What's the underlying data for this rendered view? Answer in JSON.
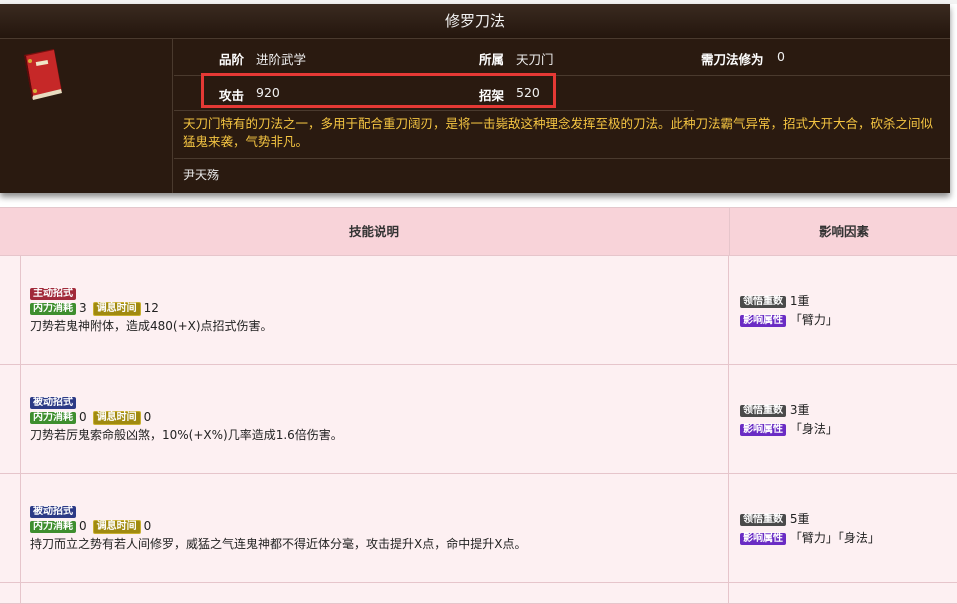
{
  "header": {
    "title": "修罗刀法",
    "grade_label": "品阶",
    "grade_value": "进阶武学",
    "belong_label": "所属",
    "belong_value": "天刀门",
    "req_label": "需刀法修为",
    "req_value": "0",
    "attack_label": "攻击",
    "attack_value": "920",
    "parry_label": "招架",
    "parry_value": "520",
    "description": "天刀门特有的刀法之一，多用于配合重刀阔刃，是将一击毙敌这种理念发挥至极的刀法。此种刀法霸气异常，招式大开大合，砍杀之间似猛鬼来袭，气势非凡。",
    "author": "尹天殇",
    "icon": "red-book-icon"
  },
  "table": {
    "col1_header": "技能说明",
    "col2_header": "影响因素",
    "tag_neili": "内力消耗",
    "tag_cd": "调息时间",
    "tag_level": "领悟重数",
    "tag_attr": "影响属性",
    "rows": [
      {
        "type": "主动招式",
        "neili": "3",
        "cd": "12",
        "text": "刀势若鬼神附体，造成480(+X)点招式伤害。",
        "level": "1重",
        "attrs": "「臂力」"
      },
      {
        "type": "被动招式",
        "neili": "0",
        "cd": "0",
        "text": "刀势若厉鬼索命般凶煞，10%(+X%)几率造成1.6倍伤害。",
        "level": "3重",
        "attrs": "「身法」"
      },
      {
        "type": "被动招式",
        "neili": "0",
        "cd": "0",
        "text": "持刀而立之势有若人间修罗，威猛之气连鬼神都不得近体分毫，攻击提升X点，命中提升X点。",
        "level": "5重",
        "attrs": "「臂力」「身法」"
      }
    ]
  },
  "colors": {
    "panel_bg": "#2a1a10",
    "description_text": "#f5c542",
    "highlight_border": "#e53935",
    "table_header_bg": "#f8d3d9",
    "row_bg": "#fdf0f2",
    "active_tag": "#a12a3a",
    "passive_tag": "#2c3a86"
  }
}
